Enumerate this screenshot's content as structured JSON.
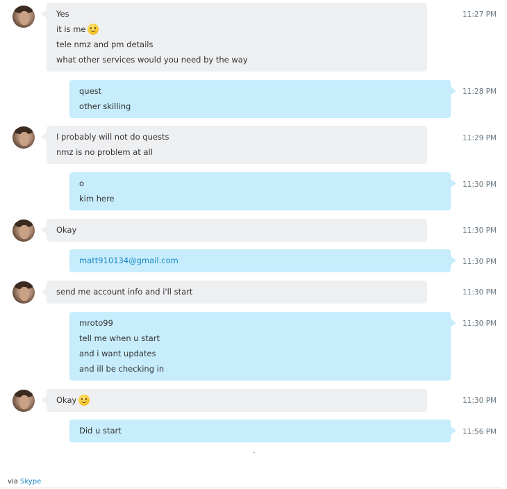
{
  "messages": [
    {
      "from": "in",
      "lines": [
        "Yes",
        "it is me",
        "tele nmz and pm details",
        "what other services would you need by the way"
      ],
      "emoji_after_line": 1,
      "time": "11:27 PM"
    },
    {
      "from": "out",
      "lines": [
        "quest",
        "other skilling"
      ],
      "time": "11:28 PM"
    },
    {
      "from": "in",
      "lines": [
        "I probably will not do quests",
        "nmz is no problem at all"
      ],
      "time": "11:29 PM"
    },
    {
      "from": "out",
      "lines": [
        "o",
        "kim here"
      ],
      "time": "11:30 PM"
    },
    {
      "from": "in",
      "lines": [
        "Okay"
      ],
      "time": "11:30 PM"
    },
    {
      "from": "out",
      "lines": [
        "matt910134@gmail.com"
      ],
      "link": true,
      "time": "11:30 PM"
    },
    {
      "from": "in",
      "lines": [
        "send me account info and i'll start"
      ],
      "time": "11:30 PM"
    },
    {
      "from": "out",
      "lines": [
        "mroto99",
        "tell me when u start",
        "and i want updates",
        "and ill be checking in"
      ],
      "time": "11:30 PM"
    },
    {
      "from": "in",
      "lines": [
        "Okay"
      ],
      "emoji_after_line": 0,
      "time": "11:30 PM"
    },
    {
      "from": "out",
      "lines": [
        "Did u start"
      ],
      "time": "11:56 PM"
    }
  ],
  "emoji_icon": "smiley-emoji-icon",
  "footer": {
    "via": "via",
    "service": "Skype"
  },
  "colors": {
    "incoming_bubble": "#eeeff1",
    "outgoing_bubble": "#c7edfc",
    "link": "#1a86c5",
    "timestamp": "#6b7a85"
  }
}
